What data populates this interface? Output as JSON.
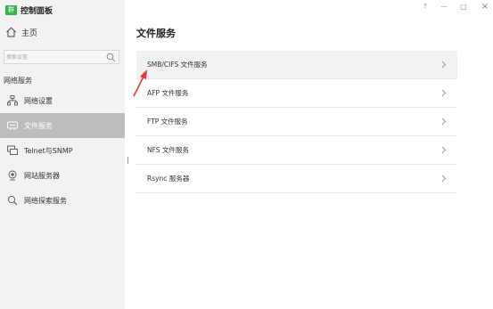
{
  "app": {
    "logo_text": "群",
    "title": "控制面板"
  },
  "window_controls": {
    "help": "?",
    "minimize": "—",
    "maximize": "□",
    "close": "×"
  },
  "sidebar": {
    "home_label": "主页",
    "search_placeholder": "搜索设置",
    "section_title": "网络服务",
    "items": [
      {
        "label": "网络设置",
        "icon": "network-icon",
        "active": false
      },
      {
        "label": "文件服务",
        "icon": "file-service-icon",
        "active": true
      },
      {
        "label": "Telnet与SNMP",
        "icon": "terminal-icon",
        "active": false
      },
      {
        "label": "网站服务器",
        "icon": "globe-icon",
        "active": false
      },
      {
        "label": "网络探索服务",
        "icon": "search-network-icon",
        "active": false
      }
    ]
  },
  "main": {
    "title": "文件服务",
    "rows": [
      {
        "label": "SMB/CIFS 文件服务"
      },
      {
        "label": "AFP 文件服务"
      },
      {
        "label": "FTP 文件服务"
      },
      {
        "label": "NFS 文件服务"
      },
      {
        "label": "Rsync 服务器"
      }
    ]
  },
  "colors": {
    "accent_green": "#2fb94a",
    "active_item": "#bdbdbd",
    "arrow_red": "#e53935"
  }
}
